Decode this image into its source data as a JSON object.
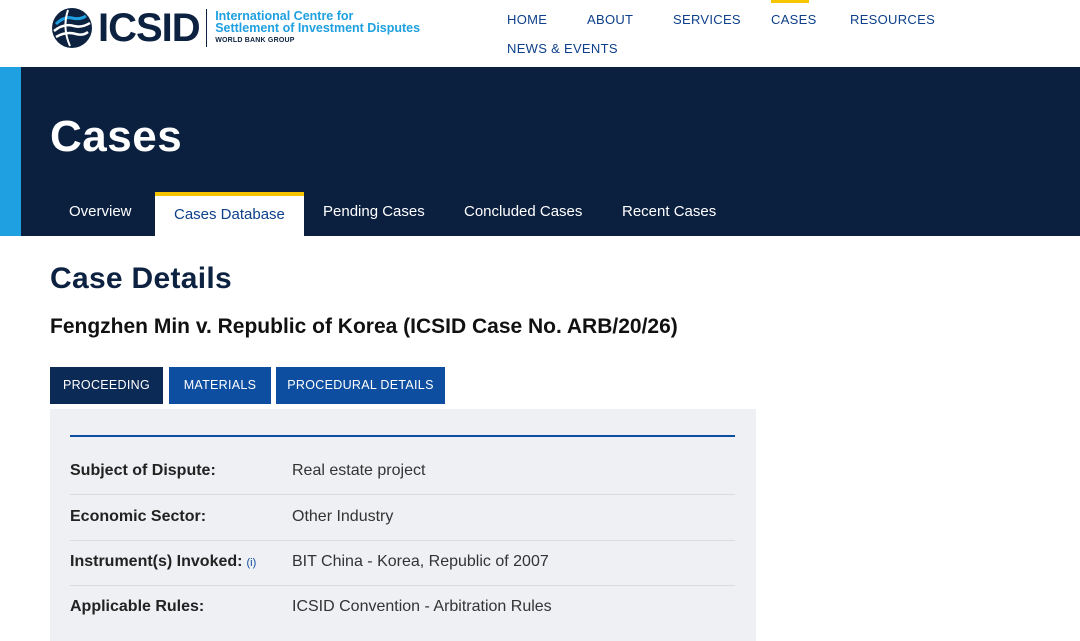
{
  "header": {
    "logo_word": "ICSID",
    "logo_line1": "International Centre for",
    "logo_line2": "Settlement of Investment Disputes",
    "logo_line3": "WORLD BANK GROUP",
    "nav": [
      "HOME",
      "ABOUT",
      "SERVICES",
      "CASES",
      "RESOURCES",
      "NEWS & EVENTS"
    ],
    "active_nav": "CASES"
  },
  "hero": {
    "title": "Cases",
    "tabs": [
      "Overview",
      "Cases Database",
      "Pending Cases",
      "Concluded Cases",
      "Recent Cases"
    ],
    "active_tab": "Cases Database"
  },
  "main": {
    "heading": "Case Details",
    "case_name": "Fengzhen Min v. Republic of Korea (ICSID Case No. ARB/20/26)",
    "subtabs": [
      "PROCEEDING",
      "MATERIALS",
      "PROCEDURAL DETAILS"
    ],
    "active_subtab": "PROCEEDING",
    "details": [
      {
        "label": "Subject of Dispute:",
        "value": "Real estate project"
      },
      {
        "label": "Economic Sector:",
        "value": "Other Industry"
      },
      {
        "label": "Instrument(s) Invoked:",
        "info": "(i)",
        "value": "BIT China - Korea, Republic of 2007"
      },
      {
        "label": "Applicable Rules:",
        "value": "ICSID Convention - Arbitration Rules"
      }
    ]
  },
  "colors": {
    "navy": "#0b1f3f",
    "accent_blue": "#1fa0e0",
    "link_blue": "#0d3f8a",
    "active_yellow": "#f7c400",
    "button_blue": "#0d4ea0"
  }
}
